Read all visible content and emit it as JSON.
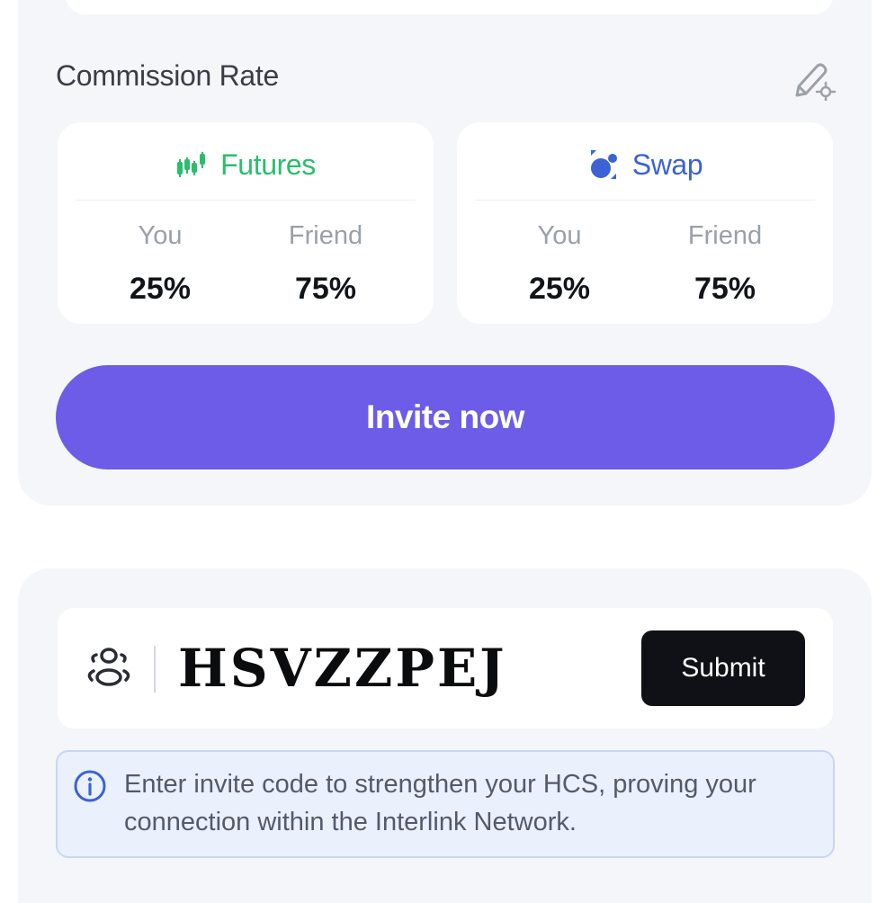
{
  "commission": {
    "title": "Commission Rate",
    "edit_icon": "edit-settings-icon",
    "futures": {
      "label": "Futures",
      "icon": "candlestick-chart-icon",
      "color": "#2bbd6e",
      "you_label": "You",
      "you_value": "25%",
      "friend_label": "Friend",
      "friend_value": "75%"
    },
    "swap": {
      "label": "Swap",
      "icon": "swap-bubbles-icon",
      "color": "#3c62d6",
      "you_label": "You",
      "you_value": "25%",
      "friend_label": "Friend",
      "friend_value": "75%"
    },
    "invite_button": "Invite now",
    "invite_color": "#6c5ce7"
  },
  "invite_code": {
    "icon": "users-icon",
    "code": "HSVZZPEJ",
    "submit_label": "Submit",
    "info_icon": "info-icon",
    "info_text": "Enter invite code to strengthen your HCS, proving your connection within the Interlink Network."
  }
}
